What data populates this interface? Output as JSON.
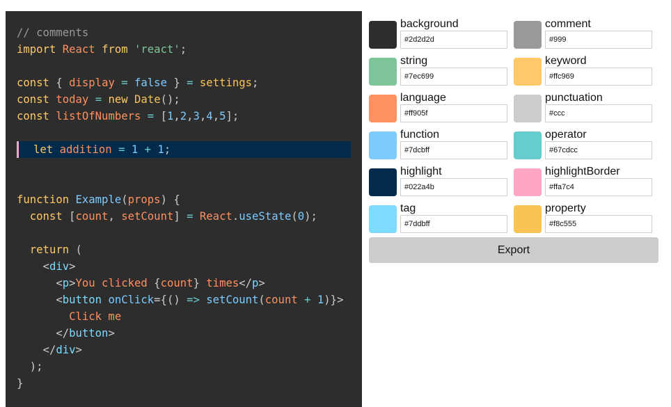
{
  "code": {
    "lines": [
      [
        {
          "t": "// comments",
          "c": "comment"
        }
      ],
      [
        {
          "t": "import ",
          "c": "keyword"
        },
        {
          "t": "React ",
          "c": "lang"
        },
        {
          "t": "from ",
          "c": "keyword"
        },
        {
          "t": "'react'",
          "c": "string"
        },
        {
          "t": ";",
          "c": "punct"
        }
      ],
      [],
      [
        {
          "t": "const ",
          "c": "keyword"
        },
        {
          "t": "{ ",
          "c": "punct"
        },
        {
          "t": "display ",
          "c": "lang"
        },
        {
          "t": "= ",
          "c": "op"
        },
        {
          "t": "false ",
          "c": "func"
        },
        {
          "t": "} ",
          "c": "punct"
        },
        {
          "t": "= ",
          "c": "op"
        },
        {
          "t": "settings",
          "c": "prop"
        },
        {
          "t": ";",
          "c": "punct"
        }
      ],
      [
        {
          "t": "const ",
          "c": "keyword"
        },
        {
          "t": "today ",
          "c": "lang"
        },
        {
          "t": "= ",
          "c": "op"
        },
        {
          "t": "new ",
          "c": "keyword"
        },
        {
          "t": "Date",
          "c": "prop"
        },
        {
          "t": "();",
          "c": "punct"
        }
      ],
      [
        {
          "t": "const ",
          "c": "keyword"
        },
        {
          "t": "listOfNumbers ",
          "c": "lang"
        },
        {
          "t": "= ",
          "c": "op"
        },
        {
          "t": "[",
          "c": "punct"
        },
        {
          "t": "1",
          "c": "func"
        },
        {
          "t": ",",
          "c": "punct"
        },
        {
          "t": "2",
          "c": "func"
        },
        {
          "t": ",",
          "c": "punct"
        },
        {
          "t": "3",
          "c": "func"
        },
        {
          "t": ",",
          "c": "punct"
        },
        {
          "t": "4",
          "c": "func"
        },
        {
          "t": ",",
          "c": "punct"
        },
        {
          "t": "5",
          "c": "func"
        },
        {
          "t": "];",
          "c": "punct"
        }
      ],
      [],
      {
        "highlight": true,
        "tokens": [
          {
            "t": "let ",
            "c": "keyword"
          },
          {
            "t": "addition ",
            "c": "lang"
          },
          {
            "t": "= ",
            "c": "op"
          },
          {
            "t": "1 ",
            "c": "func"
          },
          {
            "t": "+ ",
            "c": "op"
          },
          {
            "t": "1",
            "c": "func"
          },
          {
            "t": ";",
            "c": "punct"
          }
        ]
      },
      [],
      [],
      [
        {
          "t": "function ",
          "c": "keyword"
        },
        {
          "t": "Example",
          "c": "func"
        },
        {
          "t": "(",
          "c": "punct"
        },
        {
          "t": "props",
          "c": "lang"
        },
        {
          "t": ") {",
          "c": "punct"
        }
      ],
      [
        {
          "t": "  const ",
          "c": "keyword"
        },
        {
          "t": "[",
          "c": "punct"
        },
        {
          "t": "count",
          "c": "lang"
        },
        {
          "t": ", ",
          "c": "punct"
        },
        {
          "t": "setCount",
          "c": "lang"
        },
        {
          "t": "] ",
          "c": "punct"
        },
        {
          "t": "= ",
          "c": "op"
        },
        {
          "t": "React",
          "c": "lang"
        },
        {
          "t": ".",
          "c": "punct"
        },
        {
          "t": "useState",
          "c": "func"
        },
        {
          "t": "(",
          "c": "punct"
        },
        {
          "t": "0",
          "c": "func"
        },
        {
          "t": ");",
          "c": "punct"
        }
      ],
      [],
      [
        {
          "t": "  return ",
          "c": "keyword"
        },
        {
          "t": "(",
          "c": "punct"
        }
      ],
      [
        {
          "t": "    <",
          "c": "punct"
        },
        {
          "t": "div",
          "c": "tag"
        },
        {
          "t": ">",
          "c": "punct"
        }
      ],
      [
        {
          "t": "      <",
          "c": "punct"
        },
        {
          "t": "p",
          "c": "tag"
        },
        {
          "t": ">",
          "c": "punct"
        },
        {
          "t": "You clicked ",
          "c": "lang"
        },
        {
          "t": "{",
          "c": "punct"
        },
        {
          "t": "count",
          "c": "lang"
        },
        {
          "t": "} ",
          "c": "punct"
        },
        {
          "t": "times",
          "c": "lang"
        },
        {
          "t": "</",
          "c": "punct"
        },
        {
          "t": "p",
          "c": "tag"
        },
        {
          "t": ">",
          "c": "punct"
        }
      ],
      [
        {
          "t": "      <",
          "c": "punct"
        },
        {
          "t": "button ",
          "c": "tag"
        },
        {
          "t": "onClick",
          "c": "func"
        },
        {
          "t": "={",
          "c": "punct"
        },
        {
          "t": "() ",
          "c": "punct"
        },
        {
          "t": "=> ",
          "c": "op"
        },
        {
          "t": "setCount",
          "c": "func"
        },
        {
          "t": "(",
          "c": "punct"
        },
        {
          "t": "count ",
          "c": "lang"
        },
        {
          "t": "+ ",
          "c": "op"
        },
        {
          "t": "1",
          "c": "func"
        },
        {
          "t": ")}>",
          "c": "punct"
        }
      ],
      [
        {
          "t": "        Click me",
          "c": "lang"
        }
      ],
      [
        {
          "t": "      </",
          "c": "punct"
        },
        {
          "t": "button",
          "c": "tag"
        },
        {
          "t": ">",
          "c": "punct"
        }
      ],
      [
        {
          "t": "    </",
          "c": "punct"
        },
        {
          "t": "div",
          "c": "tag"
        },
        {
          "t": ">",
          "c": "punct"
        }
      ],
      [
        {
          "t": "  );",
          "c": "punct"
        }
      ],
      [
        {
          "t": "}",
          "c": "punct"
        }
      ]
    ]
  },
  "colors": [
    {
      "label": "background",
      "value": "#2d2d2d",
      "swatch": "#2d2d2d"
    },
    {
      "label": "comment",
      "value": "#999",
      "swatch": "#999999"
    },
    {
      "label": "string",
      "value": "#7ec699",
      "swatch": "#7ec699"
    },
    {
      "label": "keyword",
      "value": "#ffc969",
      "swatch": "#ffc969"
    },
    {
      "label": "language",
      "value": "#ff905f",
      "swatch": "#ff905f"
    },
    {
      "label": "punctuation",
      "value": "#ccc",
      "swatch": "#cccccc"
    },
    {
      "label": "function",
      "value": "#7dcbff",
      "swatch": "#7dcbff"
    },
    {
      "label": "operator",
      "value": "#67cdcc",
      "swatch": "#67cdcc"
    },
    {
      "label": "highlight",
      "value": "#022a4b",
      "swatch": "#022a4b"
    },
    {
      "label": "highlightBorder",
      "value": "#ffa7c4",
      "swatch": "#ffa7c4"
    },
    {
      "label": "tag",
      "value": "#7ddbff",
      "swatch": "#7ddbff"
    },
    {
      "label": "property",
      "value": "#f8c555",
      "swatch": "#f8c555"
    }
  ],
  "export_label": "Export"
}
